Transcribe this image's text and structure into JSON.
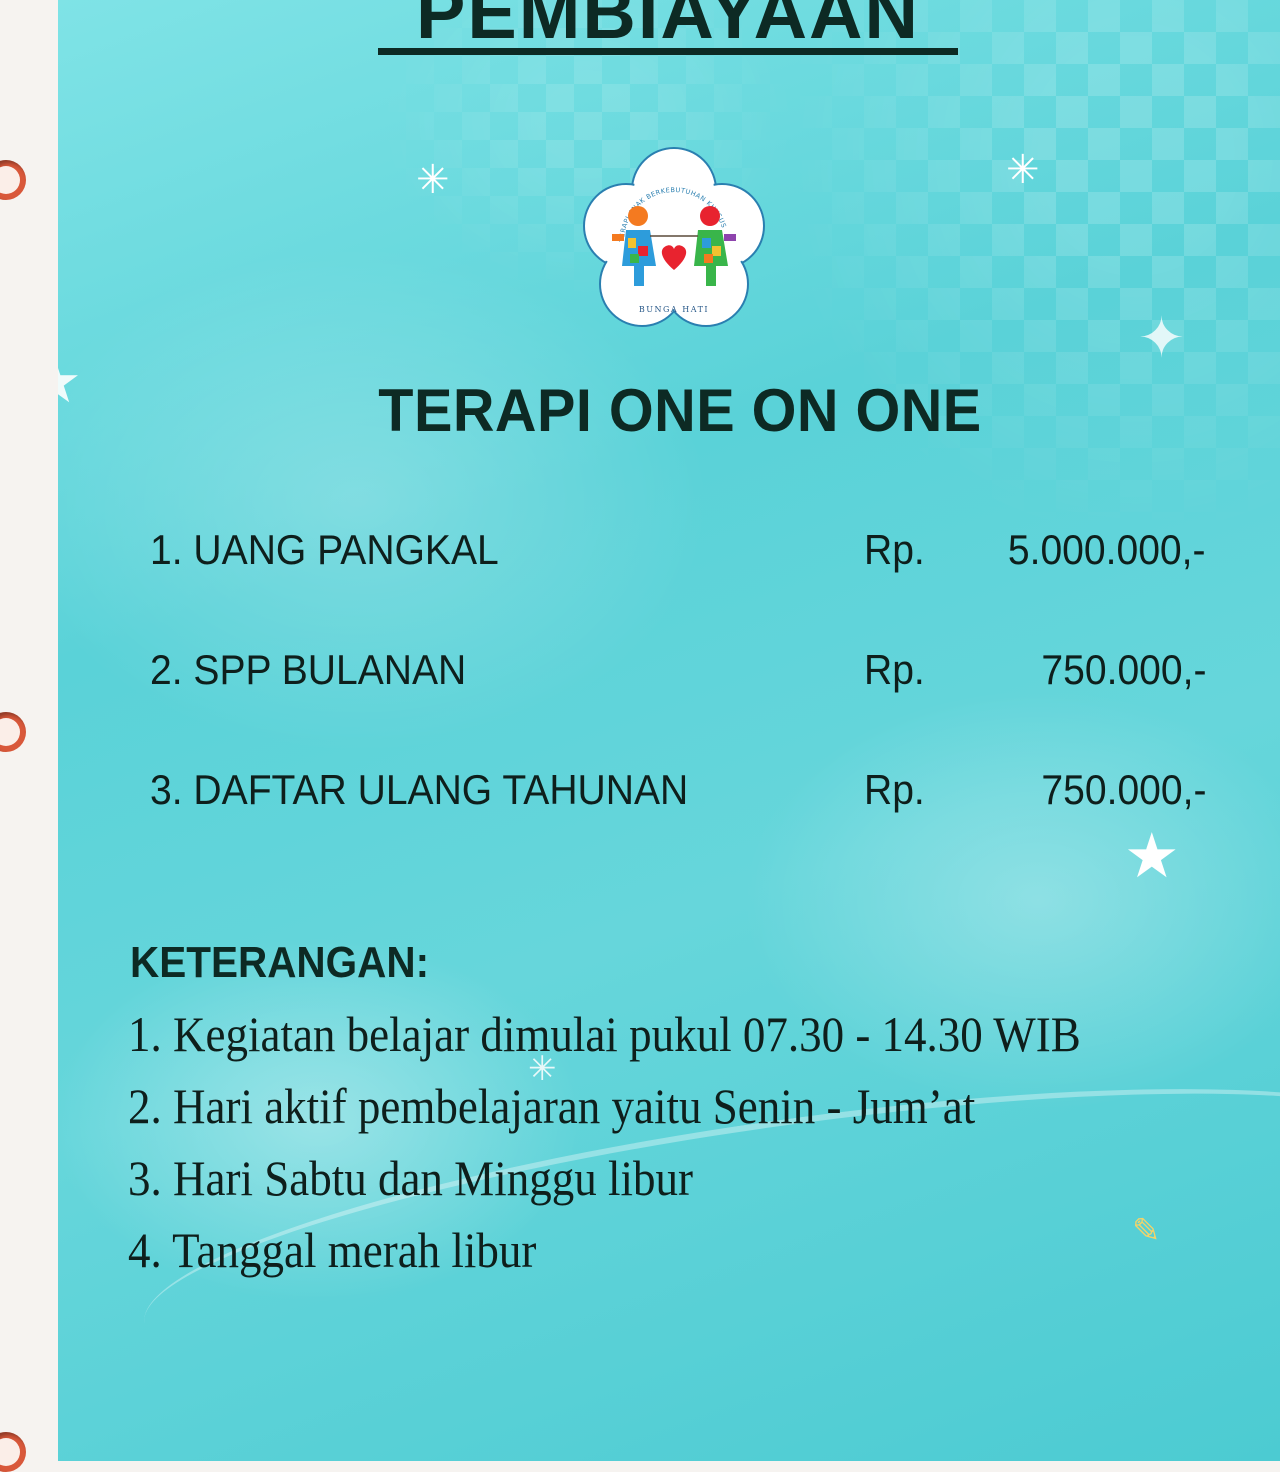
{
  "header": {
    "title": "PEMBIAYAAN"
  },
  "logo": {
    "caption": "BUNGA HATI",
    "arc_text": "TERAPI ANAK BERKEBUTUHAN KHUSUS",
    "icon": "children-heart-flower-logo"
  },
  "program": {
    "title": "TERAPI ONE ON ONE"
  },
  "fees": [
    {
      "label": "1. UANG PANGKAL",
      "currency": "Rp.",
      "amount": "5.000.000,-"
    },
    {
      "label": "2. SPP BULANAN",
      "currency": "Rp.",
      "amount": "750.000,-"
    },
    {
      "label": "3. DAFTAR ULANG TAHUNAN",
      "currency": "Rp.",
      "amount": "750.000,-"
    }
  ],
  "notes": {
    "heading": "KETERANGAN:",
    "items": [
      "1. Kegiatan belajar dimulai pukul 07.30 - 14.30 WIB",
      "2. Hari aktif pembelajaran yaitu Senin - Jum’at",
      "3. Hari Sabtu dan Minggu libur",
      "4. Tanggal merah libur"
    ]
  },
  "colors": {
    "background": "#5ad2d8",
    "text_dark": "#0d2a24",
    "heart": "#e8232f"
  }
}
